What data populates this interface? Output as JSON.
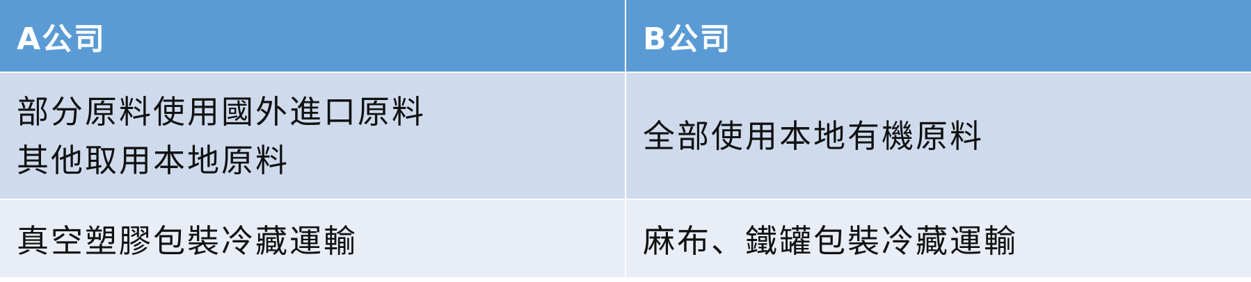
{
  "table": {
    "headers": [
      "A公司",
      "B公司"
    ],
    "rows": [
      {
        "a_lines": [
          "部分原料使用國外進口原料",
          "其他取用本地原料"
        ],
        "b": "全部使用本地有機原料"
      },
      {
        "a": "真空塑膠包裝冷藏運輸",
        "b": "麻布、鐵罐包裝冷藏運輸"
      }
    ]
  },
  "colors": {
    "header_bg": "#5b9bd5",
    "row1_bg": "#cfdbed",
    "row2_bg": "#e8edf6"
  }
}
